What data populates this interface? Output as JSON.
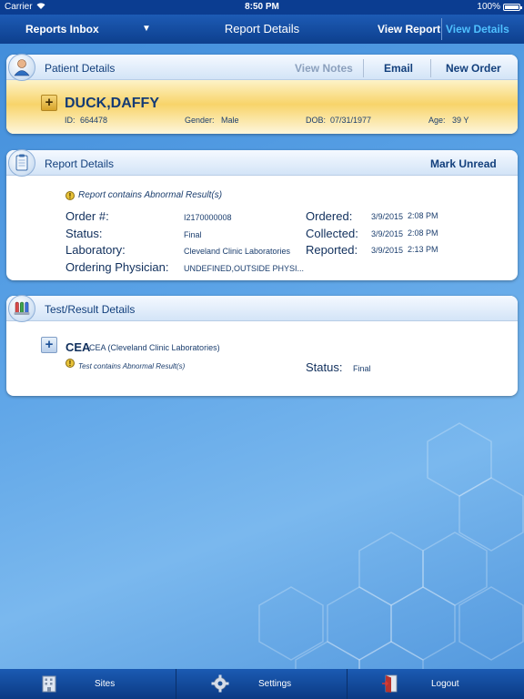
{
  "status_bar": {
    "carrier": "Carrier",
    "time": "8:50 PM",
    "battery": "100%"
  },
  "nav": {
    "inbox_label": "Reports Inbox",
    "title": "Report Details",
    "view_report": "View Report",
    "view_details": "View Details"
  },
  "patient": {
    "header": "Patient Details",
    "view_notes": "View Notes",
    "email": "Email",
    "new_order": "New Order",
    "name": "DUCK,DAFFY",
    "id_label": "ID:",
    "id": "664478",
    "gender_label": "Gender:",
    "gender": "Male",
    "dob_label": "DOB:",
    "dob": "07/31/1977",
    "age_label": "Age:",
    "age": "39 Y"
  },
  "report": {
    "header": "Report Details",
    "mark_unread": "Mark Unread",
    "abnormal_note": "Report contains Abnormal Result(s)",
    "order_label": "Order #:",
    "order": "I2170000008",
    "status_label": "Status:",
    "status": "Final",
    "laboratory_label": "Laboratory:",
    "laboratory": "Cleveland Clinic Laboratories",
    "physician_label": "Ordering Physician:",
    "physician": "UNDEFINED,OUTSIDE PHYSI...",
    "ordered_label": "Ordered:",
    "ordered_date": "3/9/2015",
    "ordered_time": "2:08 PM",
    "collected_label": "Collected:",
    "collected_date": "3/9/2015",
    "collected_time": "2:08 PM",
    "reported_label": "Reported:",
    "reported_date": "3/9/2015",
    "reported_time": "2:13 PM"
  },
  "tests": {
    "header": "Test/Result Details",
    "items": [
      {
        "code": "CEA",
        "description": "CEA (Cleveland Clinic Laboratories)",
        "abnormal_note": "Test contains Abnormal Result(s)",
        "status_label": "Status:",
        "status": "Final"
      }
    ]
  },
  "tabbar": {
    "sites": "Sites",
    "settings": "Settings",
    "logout": "Logout"
  },
  "colors": {
    "nav_bar": "#0d3f8d",
    "accent_selected": "#4fc0ff",
    "patient_band": "#f8d46a",
    "background": "#5aa2e6"
  },
  "icons": [
    "wifi-icon",
    "battery-icon",
    "dropdown-caret-icon",
    "patient-person-icon",
    "clipboard-icon",
    "test-tubes-icon",
    "expand-plus-icon",
    "warning-icon",
    "sites-building-icon",
    "settings-gear-icon",
    "logout-door-icon"
  ]
}
